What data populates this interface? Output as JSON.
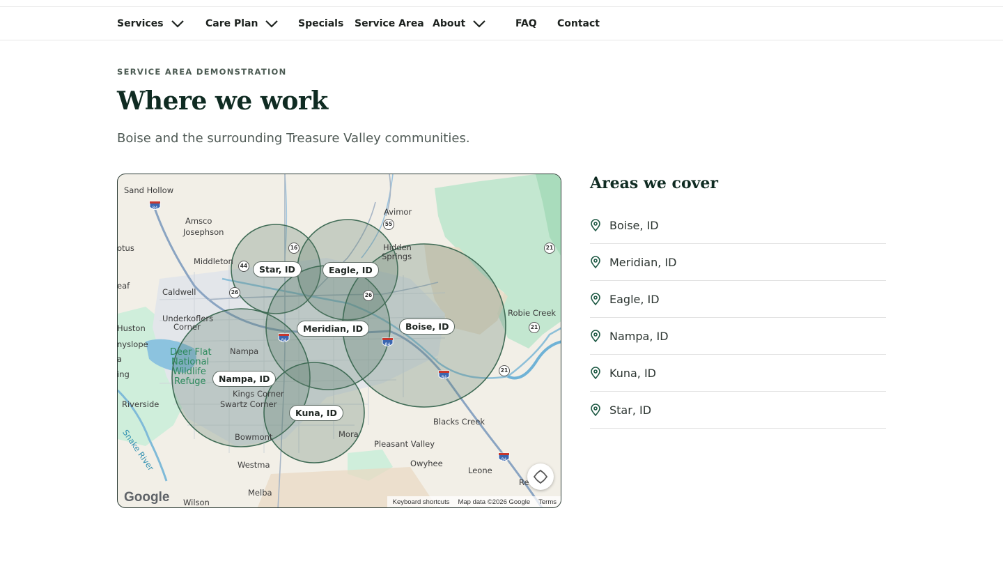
{
  "nav": {
    "items": [
      {
        "label": "Services",
        "has_dropdown": true
      },
      {
        "label": "Care Plan",
        "has_dropdown": true
      },
      {
        "label": "Specials",
        "has_dropdown": false
      },
      {
        "label": "Service Area",
        "has_dropdown": false
      },
      {
        "label": "About",
        "has_dropdown": true
      },
      {
        "label": "FAQ",
        "has_dropdown": false
      },
      {
        "label": "Contact",
        "has_dropdown": false
      }
    ]
  },
  "hero": {
    "eyebrow": "SERVICE AREA DEMONSTRATION",
    "title": "Where we work",
    "subtitle": "Boise and the surrounding Treasure Valley communities."
  },
  "map": {
    "service_pills": [
      "Star, ID",
      "Eagle, ID",
      "Meridian, ID",
      "Boise, ID",
      "Nampa, ID",
      "Kuna, ID"
    ],
    "places": [
      "Sand Hollow",
      "Amsco",
      "Josephson",
      "otus",
      "Middleton",
      "Caldwell",
      "eaf",
      "Underkoflers",
      "Corner",
      "Huston",
      "nyslope",
      "a",
      "Deer Flat",
      "National",
      "Wildlife",
      "Refuge",
      "ing",
      "Nampa",
      "Kings Corner",
      "Swartz Corner",
      "Riverside",
      "Snake River",
      "Bowmont",
      "Westma",
      "Melba",
      "Wilson",
      "Mora",
      "Pleasant Valley",
      "Owyhee",
      "Leone",
      "Re",
      "Blacks Creek",
      "Avimor",
      "Hidden",
      "Springs",
      "Robie Creek"
    ],
    "highway_labels": [
      "84",
      "16",
      "44",
      "26",
      "26",
      "55",
      "21",
      "21",
      "21",
      "84",
      "84",
      "84",
      "84"
    ],
    "logo": "Google",
    "attribution": [
      "Keyboard shortcuts",
      "Map data ©2026 Google",
      "Terms"
    ],
    "colors": {
      "land": "#f2efe7",
      "park": "#bfe6cc",
      "urban": "#e3e6ea",
      "water": "#7fbad8",
      "zone_fill": "#5a7a68",
      "zone_stroke": "#3f6b55"
    }
  },
  "areas": {
    "title": "Areas we cover",
    "items": [
      "Boise, ID",
      "Meridian, ID",
      "Eagle, ID",
      "Nampa, ID",
      "Kuna, ID",
      "Star, ID"
    ],
    "icon": "map-pin-icon"
  }
}
